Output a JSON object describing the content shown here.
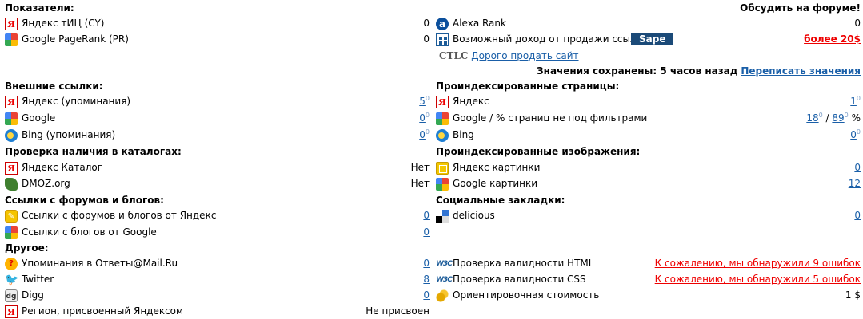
{
  "left": {
    "indicators": {
      "heading": "Показатели:",
      "rows": [
        {
          "label": "Яндекс тИЦ (CY)",
          "value": "0",
          "icon": "yandex-icon"
        },
        {
          "label": "Google PageRank (PR)",
          "value": "0",
          "icon": "google-icon"
        }
      ]
    },
    "external": {
      "heading": "Внешние ссылки:",
      "rows": [
        {
          "label": "Яндекс (упоминания)",
          "value": "5",
          "sup": "0",
          "icon": "yandex-icon"
        },
        {
          "label": "Google",
          "value": "0",
          "sup": "0",
          "icon": "google-icon"
        },
        {
          "label": "Bing (упоминания)",
          "value": "0",
          "sup": "0",
          "icon": "bing-icon"
        }
      ]
    },
    "catalogs": {
      "heading": "Проверка наличия в каталогах:",
      "rows": [
        {
          "label": "Яндекс Каталог",
          "value": "Нет",
          "icon": "yandex-icon"
        },
        {
          "label": "DMOZ.org",
          "value": "Нет",
          "icon": "dmoz-icon"
        }
      ]
    },
    "forums": {
      "heading": "Ссылки с форумов и блогов:",
      "rows": [
        {
          "label": "Ссылки с форумов и блогов от Яндекс",
          "value": "0",
          "icon": "yandex-blogs-icon"
        },
        {
          "label": "Ссылки с блогов от Google",
          "value": "0",
          "icon": "google-icon"
        }
      ]
    },
    "other": {
      "heading": "Другое:",
      "rows": [
        {
          "label": "Упоминания в Ответы@Mail.Ru",
          "value": "0",
          "icon": "mail-answers-icon"
        },
        {
          "label": "Twitter",
          "value": "8",
          "icon": "twitter-icon"
        },
        {
          "label": "Digg",
          "value": "0",
          "icon": "digg-icon"
        },
        {
          "label": "Регион, присвоенный Яндексом",
          "value": "Не присвоен",
          "icon": "yandex-icon"
        }
      ]
    }
  },
  "right": {
    "discuss_link": "Обсудить на форуме!",
    "alexa": {
      "label": "Alexa Rank",
      "value": "0"
    },
    "sape": {
      "label": "Возможный доход от продажи ссылок",
      "badge": "Sape",
      "value": "более 20$"
    },
    "ctlc": {
      "brand": "CTLC",
      "link": "Дорого продать сайт"
    },
    "saved": {
      "text": "Значения сохранены: 5 часов назад",
      "link": "Переписать значения"
    },
    "indexed_pages": {
      "heading": "Проиндексированные страницы:",
      "yandex": {
        "label": "Яндекс",
        "value": "1",
        "sup": "0"
      },
      "google": {
        "label": "Google / % страниц не под фильтрами",
        "value": "18",
        "sup": "0",
        "sep": "/",
        "value2": "89",
        "sup2": "0",
        "unit": "%"
      },
      "bing": {
        "label": "Bing",
        "value": "0",
        "sup": "0"
      }
    },
    "indexed_images": {
      "heading": "Проиндексированные изображения:",
      "rows": [
        {
          "label": "Яндекс картинки",
          "value": "0"
        },
        {
          "label": "Google картинки",
          "value": "12"
        }
      ]
    },
    "social": {
      "heading": "Социальные закладки:",
      "rows": [
        {
          "label": "delicious",
          "value": "0"
        }
      ]
    },
    "validity": {
      "html": {
        "label": "Проверка валидности HTML",
        "value": "К сожалению, мы обнаружили 9 ошибок"
      },
      "css": {
        "label": "Проверка валидности CSS",
        "value": "К сожалению, мы обнаружили 5 ошибок"
      },
      "price": {
        "label": "Ориентировочная стоимость",
        "value": "1 $"
      }
    }
  },
  "icons": {
    "w3c": "W3C"
  }
}
